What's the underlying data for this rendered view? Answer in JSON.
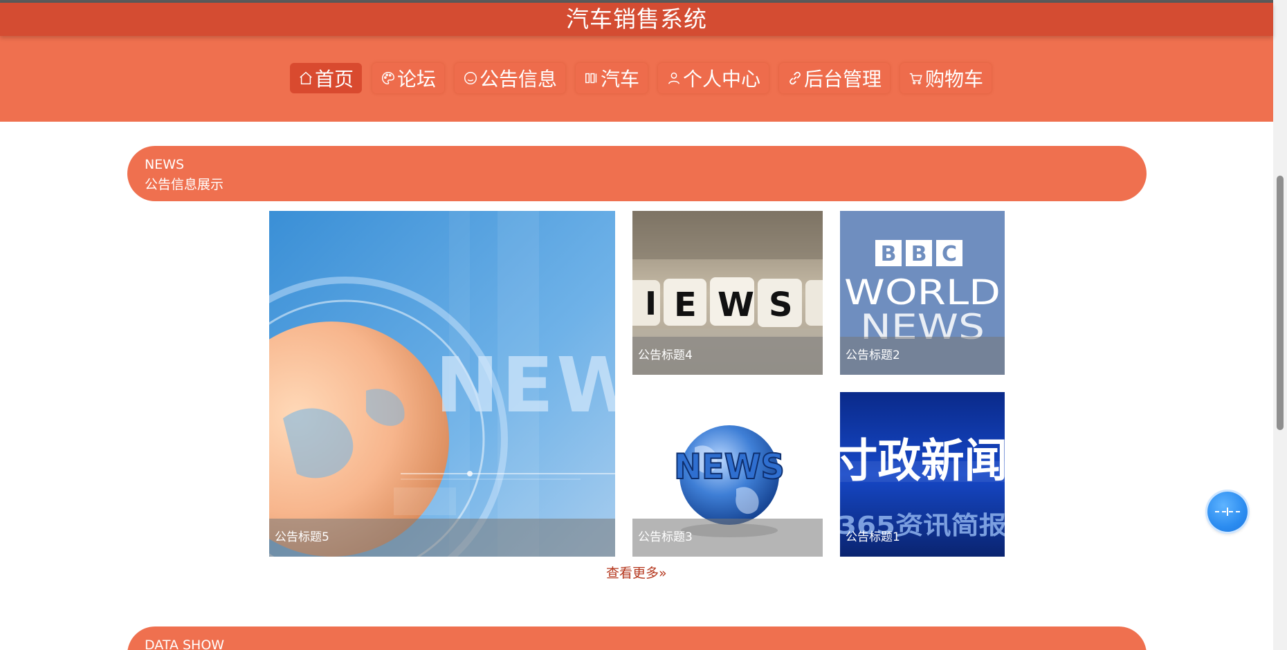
{
  "header": {
    "title": "汽车销售系统"
  },
  "nav": {
    "items": [
      {
        "label": "首页",
        "icon": "home-icon",
        "active": true
      },
      {
        "label": "论坛",
        "icon": "palette-icon",
        "active": false
      },
      {
        "label": "公告信息",
        "icon": "smile-icon",
        "active": false
      },
      {
        "label": "汽车",
        "icon": "columns-icon",
        "active": false
      },
      {
        "label": "个人中心",
        "icon": "user-icon",
        "active": false
      },
      {
        "label": "后台管理",
        "icon": "link-icon",
        "active": false
      },
      {
        "label": "购物车",
        "icon": "cart-icon",
        "active": false
      }
    ]
  },
  "news_section": {
    "title_en": "NEWS",
    "title_cn": "公告信息展示",
    "items": [
      {
        "caption": "公告标题5",
        "image": "news-globe-blue"
      },
      {
        "caption": "公告标题4",
        "image": "news-letter-cubes"
      },
      {
        "caption": "公告标题2",
        "image": "bbc-world-news"
      },
      {
        "caption": "公告标题3",
        "image": "news-globe-white"
      },
      {
        "caption": "公告标题1",
        "image": "shizheng-xinwen"
      }
    ],
    "more_label": "查看更多",
    "more_icon": "double-chevron-right-icon"
  },
  "data_section": {
    "title_en": "DATA SHOW"
  },
  "colors": {
    "title_bar": "#d44c32",
    "nav_background": "#ef704f",
    "active_nav": "#d94a2f",
    "banner": "#ef704f",
    "link": "#b4361c",
    "float_button": "#2b8cf0"
  },
  "float_button": {
    "icon": "drag-handle-icon"
  }
}
